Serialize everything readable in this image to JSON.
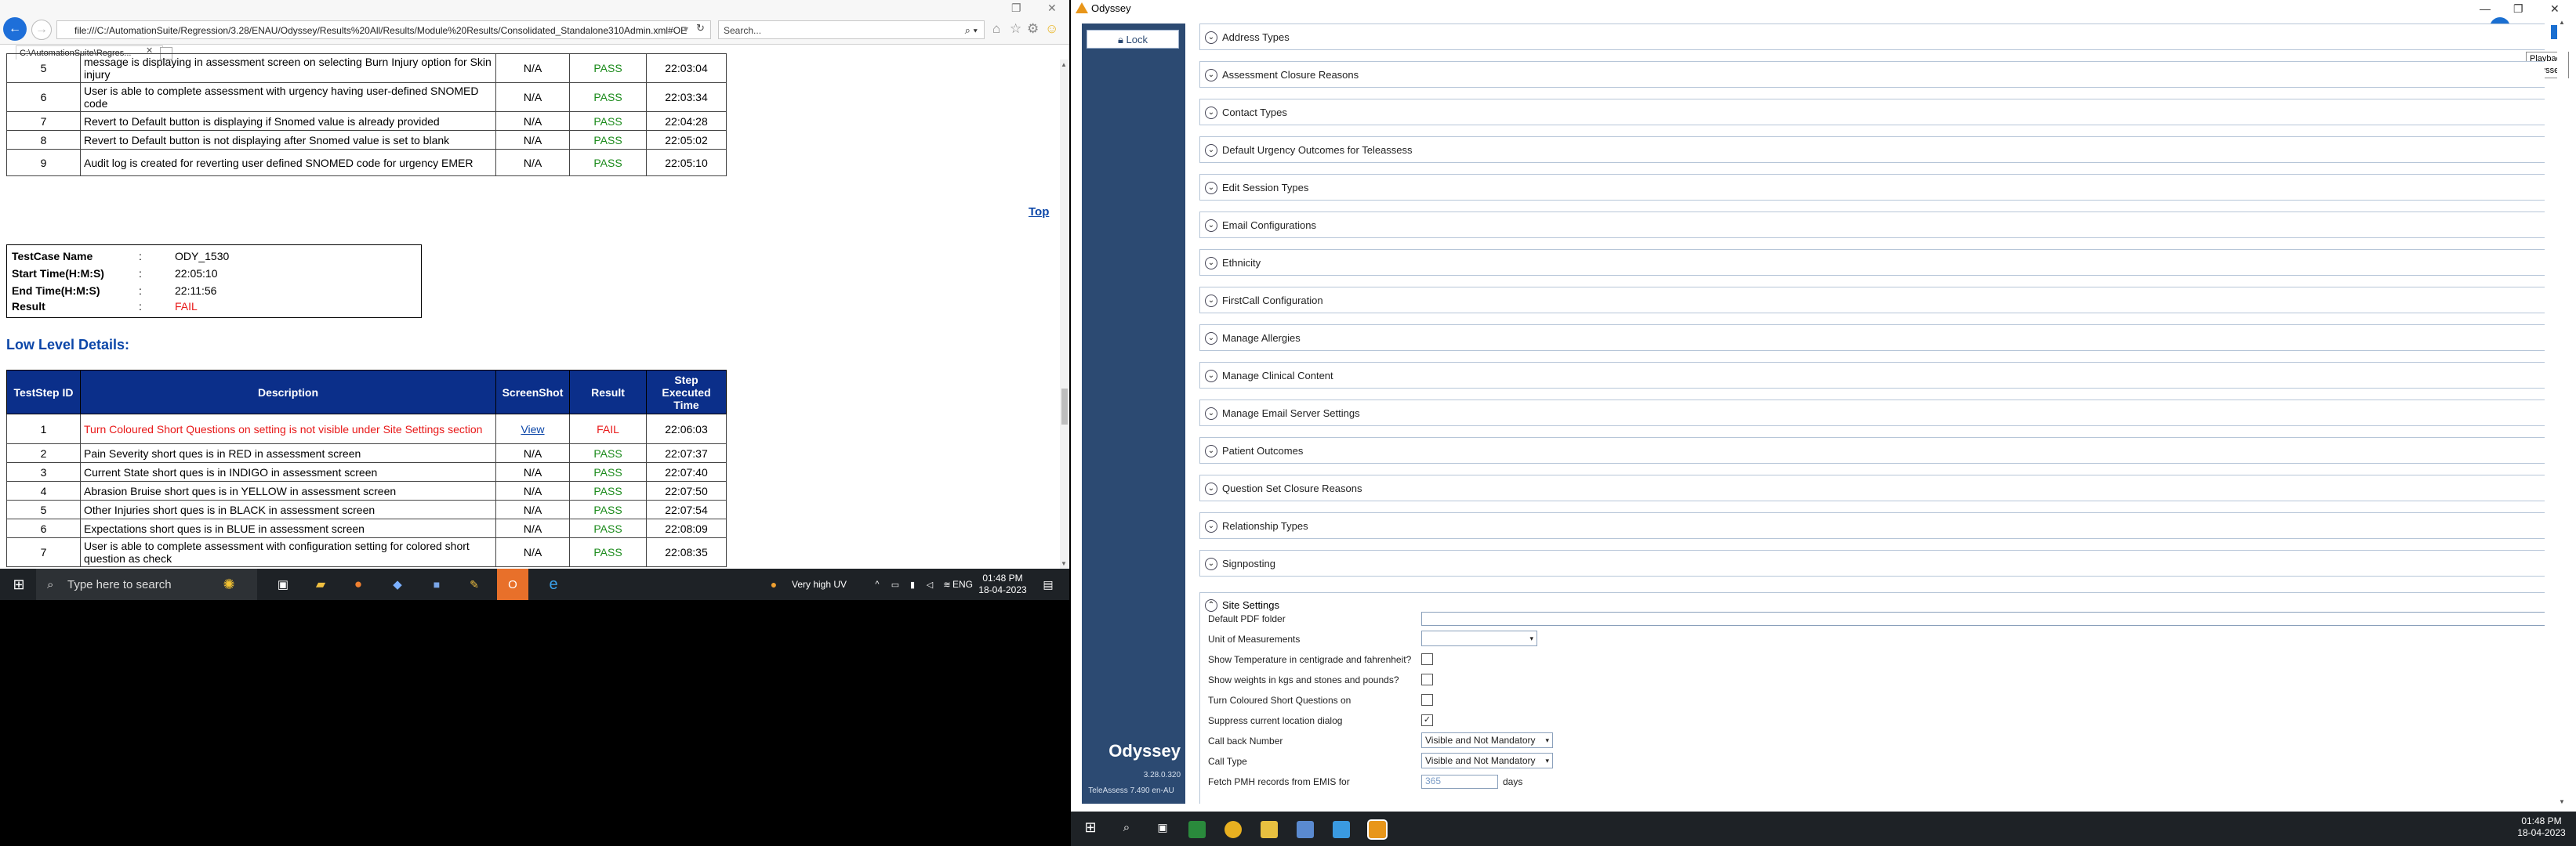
{
  "browser": {
    "address": "file:///C:/AutomationSuite/Regression/3.28/ENAU/Odyssey/Results%20All/Results/Module%20Results/Consolidated_Standalone310Admin.xml#OE",
    "search_placeholder": "Search...",
    "tab_title": "C:\\AutomationSuite\\Regres...",
    "back_icon": "arrow-left-icon"
  },
  "report": {
    "top_rows": [
      {
        "id": "5",
        "desc": "message is displaying in assessment screen on selecting Burn Injury option for Skin injury",
        "shot": "N/A",
        "result": "PASS",
        "time": "22:03:04"
      },
      {
        "id": "6",
        "desc": "User is able to complete assessment with urgency having user-defined SNOMED code",
        "shot": "N/A",
        "result": "PASS",
        "time": "22:03:34"
      },
      {
        "id": "7",
        "desc": "Revert to Default button is displaying if Snomed value is already provided",
        "shot": "N/A",
        "result": "PASS",
        "time": "22:04:28"
      },
      {
        "id": "8",
        "desc": "Revert to Default button is not displaying after Snomed value is set to blank",
        "shot": "N/A",
        "result": "PASS",
        "time": "22:05:02"
      },
      {
        "id": "9",
        "desc": "Audit log is created for reverting user defined SNOMED code for urgency EMER",
        "shot": "N/A",
        "result": "PASS",
        "time": "22:05:10"
      }
    ],
    "top_link": "Top",
    "summary": {
      "name_label": "TestCase Name",
      "name_value": "ODY_1530",
      "start_label": "Start Time(H:M:S)",
      "start_value": "22:05:10",
      "end_label": "End Time(H:M:S)",
      "end_value": "22:11:56",
      "result_label": "Result",
      "result_value": "FAIL",
      "colon": ":"
    },
    "low_level_heading": "Low Level Details:",
    "headers": {
      "id": "TestStep ID",
      "desc": "Description",
      "shot": "ScreenShot",
      "result": "Result",
      "time": "Step Executed Time"
    },
    "steps": [
      {
        "id": "1",
        "desc": "Turn Coloured Short Questions on setting is not visible under Site Settings section",
        "shot": "View",
        "result": "FAIL",
        "time": "22:06:03"
      },
      {
        "id": "2",
        "desc": "Pain Severity short ques is in RED in assessment screen",
        "shot": "N/A",
        "result": "PASS",
        "time": "22:07:37"
      },
      {
        "id": "3",
        "desc": "Current State short ques is in INDIGO in assessment screen",
        "shot": "N/A",
        "result": "PASS",
        "time": "22:07:40"
      },
      {
        "id": "4",
        "desc": "Abrasion Bruise short ques is in YELLOW in assessment screen",
        "shot": "N/A",
        "result": "PASS",
        "time": "22:07:50"
      },
      {
        "id": "5",
        "desc": "Other Injuries short ques is in BLACK in assessment screen",
        "shot": "N/A",
        "result": "PASS",
        "time": "22:07:54"
      },
      {
        "id": "6",
        "desc": "Expectations short ques is in BLUE in assessment screen",
        "shot": "N/A",
        "result": "PASS",
        "time": "22:08:09"
      },
      {
        "id": "7",
        "desc": "User is able to complete assessment with configuration setting for colored short question as check",
        "shot": "N/A",
        "result": "PASS",
        "time": "22:08:35"
      }
    ]
  },
  "taskbar_left": {
    "search_placeholder": "Type here to search",
    "weather": "Very high UV",
    "lang": "ENG",
    "time": "01:48 PM",
    "date": "18-04-2023"
  },
  "odyssey": {
    "title": "Odyssey",
    "lock_label": "Lock",
    "brand": "Odyssey",
    "version": "3.28.0.320",
    "teleassess": "TeleAssess 7.490 en-AU",
    "playback_tip": "Playback",
    "playback_tip2": "Odyssey",
    "sections": [
      "Address Types",
      "Assessment Closure Reasons",
      "Contact Types",
      "Default Urgency Outcomes for Teleassess",
      "Edit Session Types",
      "Email Configurations",
      "Ethnicity",
      "FirstCall Configuration",
      "Manage Allergies",
      "Manage Clinical Content",
      "Manage Email Server Settings",
      "Patient Outcomes",
      "Question Set Closure Reasons",
      "Relationship Types",
      "Signposting"
    ],
    "site_settings": {
      "title": "Site Settings",
      "default_pdf_label": "Default PDF folder",
      "default_pdf_value": "",
      "unit_label": "Unit of Measurements",
      "unit_value": "",
      "temp_label": "Show Temperature in centigrade and fahrenheit?",
      "temp_checked": false,
      "weights_label": "Show weights in kgs and stones and pounds?",
      "weights_checked": false,
      "coloured_label": "Turn Coloured Short Questions on",
      "coloured_checked": false,
      "suppress_label": "Suppress current location dialog",
      "suppress_checked": true,
      "callback_label": "Call back Number",
      "callback_value": "Visible and Not Mandatory",
      "calltype_label": "Call Type",
      "calltype_value": "Visible and Not Mandatory",
      "fetch_label": "Fetch PMH records from EMIS for",
      "fetch_value": "365",
      "fetch_unit": "days"
    }
  },
  "taskbar_right": {
    "time": "01:48 PM",
    "date": "18-04-2023"
  }
}
